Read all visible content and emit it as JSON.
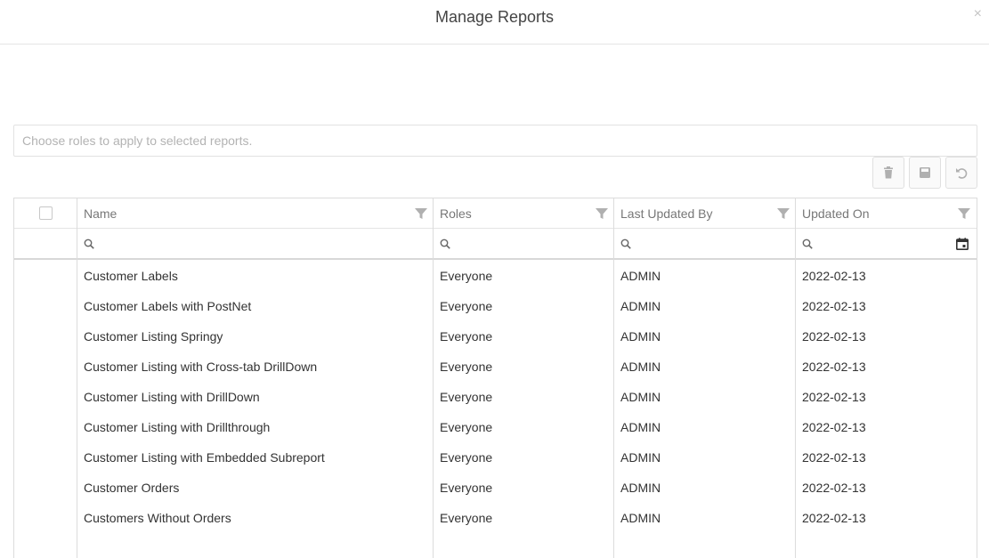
{
  "dialog": {
    "title": "Manage Reports",
    "close_glyph": "×"
  },
  "roles_input": {
    "placeholder": "Choose roles to apply to selected reports.",
    "value": ""
  },
  "toolbar": {
    "buttons": [
      {
        "name": "delete",
        "icon": "trash-icon"
      },
      {
        "name": "save",
        "icon": "save-icon"
      },
      {
        "name": "undo",
        "icon": "undo-icon"
      }
    ]
  },
  "grid": {
    "columns": [
      {
        "key": "name",
        "label": "Name"
      },
      {
        "key": "roles",
        "label": "Roles"
      },
      {
        "key": "last_updated_by",
        "label": "Last Updated By"
      },
      {
        "key": "updated_on",
        "label": "Updated On"
      }
    ],
    "filters": {
      "name": "",
      "roles": "",
      "last_updated_by": "",
      "updated_on": ""
    },
    "rows": [
      {
        "name": "Customer Labels",
        "roles": "Everyone",
        "last_updated_by": "ADMIN",
        "updated_on": "2022-02-13"
      },
      {
        "name": "Customer Labels with PostNet",
        "roles": "Everyone",
        "last_updated_by": "ADMIN",
        "updated_on": "2022-02-13"
      },
      {
        "name": "Customer Listing Springy",
        "roles": "Everyone",
        "last_updated_by": "ADMIN",
        "updated_on": "2022-02-13"
      },
      {
        "name": "Customer Listing with Cross-tab DrillDown",
        "roles": "Everyone",
        "last_updated_by": "ADMIN",
        "updated_on": "2022-02-13"
      },
      {
        "name": "Customer Listing with DrillDown",
        "roles": "Everyone",
        "last_updated_by": "ADMIN",
        "updated_on": "2022-02-13"
      },
      {
        "name": "Customer Listing with Drillthrough",
        "roles": "Everyone",
        "last_updated_by": "ADMIN",
        "updated_on": "2022-02-13"
      },
      {
        "name": "Customer Listing with Embedded Subreport",
        "roles": "Everyone",
        "last_updated_by": "ADMIN",
        "updated_on": "2022-02-13"
      },
      {
        "name": "Customer Orders",
        "roles": "Everyone",
        "last_updated_by": "ADMIN",
        "updated_on": "2022-02-13"
      },
      {
        "name": "Customers Without Orders",
        "roles": "Everyone",
        "last_updated_by": "ADMIN",
        "updated_on": "2022-02-13"
      }
    ]
  },
  "colors": {
    "border": "#dcdcdc",
    "icon": "#b0b0b0",
    "text": "#333333"
  }
}
